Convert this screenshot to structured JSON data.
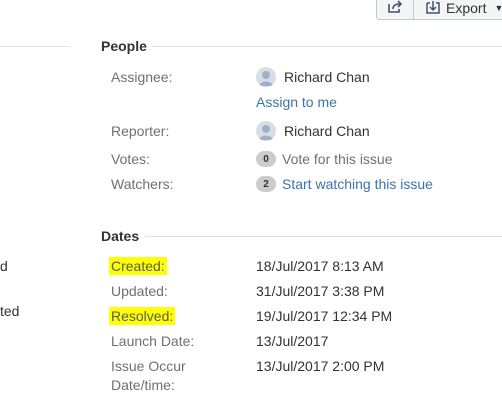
{
  "toolbar": {
    "share_icon": "share-icon",
    "export_label": "Export",
    "export_icon": "export-icon"
  },
  "left_panel": {
    "fragment_1": "d",
    "fragment_2": "ted"
  },
  "people": {
    "title": "People",
    "assignee_label": "Assignee:",
    "assignee_name": "Richard Chan",
    "assign_to_me": "Assign to me",
    "reporter_label": "Reporter:",
    "reporter_name": "Richard Chan",
    "votes_label": "Votes:",
    "votes_count": "0",
    "votes_text": "Vote for this issue",
    "watchers_label": "Watchers:",
    "watchers_count": "2",
    "watchers_text": "Start watching this issue"
  },
  "dates": {
    "title": "Dates",
    "created_label": "Created:",
    "created_value": "18/Jul/2017 8:13 AM",
    "updated_label": "Updated:",
    "updated_value": "31/Jul/2017 3:38 PM",
    "resolved_label": "Resolved:",
    "resolved_value": "19/Jul/2017 12:34 PM",
    "launch_label": "Launch Date:",
    "launch_value": "13/Jul/2017",
    "occur_label_1": "Issue Occur",
    "occur_label_2": "Date/time:",
    "occur_value": "13/Jul/2017 2:00 PM"
  },
  "colors": {
    "link": "#3b73af",
    "highlight": "#ffff00",
    "label": "#707070"
  }
}
